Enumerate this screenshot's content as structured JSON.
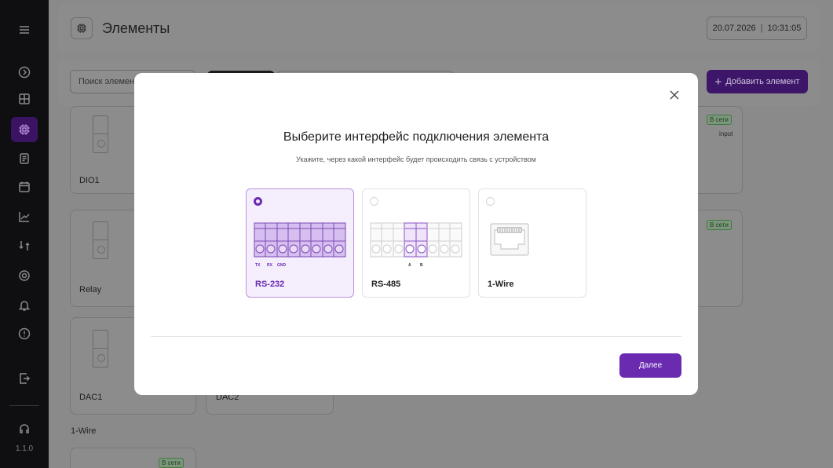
{
  "header": {
    "title": "Элементы",
    "date": "20.07.2026",
    "separator": "|",
    "time": "10:31:05"
  },
  "toolbar": {
    "search_placeholder": "Поиск элемент",
    "add_label": "Добавить элемент",
    "add_icon": "+"
  },
  "cards": [
    {
      "label": "DIO1"
    },
    {
      "label": "Relay"
    },
    {
      "label": "DAC1"
    },
    {
      "label": "DAC2"
    }
  ],
  "badges": {
    "online": "В сети",
    "input": "input"
  },
  "section": {
    "label": "1-Wire"
  },
  "sidebar": {
    "version": "1.1.0"
  },
  "modal": {
    "title": "Выберите интерфейс подключения элемента",
    "subtitle": "Укажите, через какой интерфейс будет происходить связь с устройством",
    "options": [
      {
        "name": "RS-232",
        "pins": [
          "TX",
          "RX",
          "GND"
        ],
        "selected": true
      },
      {
        "name": "RS-485",
        "pins": [
          "A",
          "B"
        ],
        "selected": false
      },
      {
        "name": "1-Wire",
        "pins": [],
        "selected": false
      }
    ],
    "next_label": "Далее"
  },
  "colors": {
    "accent": "#6a2bb0",
    "sidebar": "#0f0f12",
    "online": "#3b7d3b"
  }
}
